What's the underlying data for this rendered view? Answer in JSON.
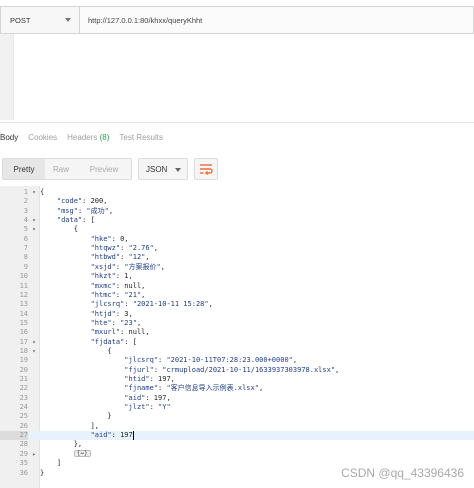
{
  "request": {
    "method": "POST",
    "url": "http://127.0.0.1:80/khxx/queryKhht"
  },
  "response_tabs": [
    {
      "label": "Body",
      "count": ""
    },
    {
      "label": "Cookies",
      "count": ""
    },
    {
      "label": "Headers",
      "count": "(8)"
    },
    {
      "label": "Test Results",
      "count": ""
    }
  ],
  "toolbar": {
    "views": [
      "Pretty",
      "Raw",
      "Preview"
    ],
    "active_view": "Pretty",
    "format": "JSON",
    "wrap_icon": "wrap-lines-icon"
  },
  "colors": {
    "highlight_line": "#e8f2ff",
    "accent": "#ef6c37",
    "string": "#1f3c8a"
  },
  "code_lines": [
    {
      "n": "1",
      "fold": "▾",
      "parts": [
        [
          "p",
          "{"
        ]
      ]
    },
    {
      "n": "2",
      "fold": "",
      "parts": [
        [
          "p",
          "    "
        ],
        [
          "k",
          "\"code\""
        ],
        [
          "p",
          ": 200,"
        ]
      ]
    },
    {
      "n": "3",
      "fold": "",
      "parts": [
        [
          "p",
          "    "
        ],
        [
          "k",
          "\"msg\""
        ],
        [
          "p",
          ": "
        ],
        [
          "s",
          "\"成功\""
        ],
        [
          "p",
          ","
        ]
      ]
    },
    {
      "n": "4",
      "fold": "▾",
      "parts": [
        [
          "p",
          "    "
        ],
        [
          "k",
          "\"data\""
        ],
        [
          "p",
          ": ["
        ]
      ]
    },
    {
      "n": "5",
      "fold": "▾",
      "parts": [
        [
          "p",
          "        {"
        ]
      ]
    },
    {
      "n": "6",
      "fold": "",
      "parts": [
        [
          "p",
          "            "
        ],
        [
          "k",
          "\"hke\""
        ],
        [
          "p",
          ": 0,"
        ]
      ]
    },
    {
      "n": "7",
      "fold": "",
      "parts": [
        [
          "p",
          "            "
        ],
        [
          "k",
          "\"htqwz\""
        ],
        [
          "p",
          ": "
        ],
        [
          "s",
          "\"2.76\""
        ],
        [
          "p",
          ","
        ]
      ]
    },
    {
      "n": "8",
      "fold": "",
      "parts": [
        [
          "p",
          "            "
        ],
        [
          "k",
          "\"htbwd\""
        ],
        [
          "p",
          ": "
        ],
        [
          "s",
          "\"12\""
        ],
        [
          "p",
          ","
        ]
      ]
    },
    {
      "n": "9",
      "fold": "",
      "parts": [
        [
          "p",
          "            "
        ],
        [
          "k",
          "\"xsjd\""
        ],
        [
          "p",
          ": "
        ],
        [
          "s",
          "\"方案报价\""
        ],
        [
          "p",
          ","
        ]
      ]
    },
    {
      "n": "10",
      "fold": "",
      "parts": [
        [
          "p",
          "            "
        ],
        [
          "k",
          "\"hkzt\""
        ],
        [
          "p",
          ": 1,"
        ]
      ]
    },
    {
      "n": "11",
      "fold": "",
      "parts": [
        [
          "p",
          "            "
        ],
        [
          "k",
          "\"mxmc\""
        ],
        [
          "p",
          ": null,"
        ]
      ]
    },
    {
      "n": "12",
      "fold": "",
      "parts": [
        [
          "p",
          "            "
        ],
        [
          "k",
          "\"htmc\""
        ],
        [
          "p",
          ": "
        ],
        [
          "s",
          "\"21\""
        ],
        [
          "p",
          ","
        ]
      ]
    },
    {
      "n": "13",
      "fold": "",
      "parts": [
        [
          "p",
          "            "
        ],
        [
          "k",
          "\"jlcsrq\""
        ],
        [
          "p",
          ": "
        ],
        [
          "s",
          "\"2021-10-11 15:28\""
        ],
        [
          "p",
          ","
        ]
      ]
    },
    {
      "n": "14",
      "fold": "",
      "parts": [
        [
          "p",
          "            "
        ],
        [
          "k",
          "\"htjd\""
        ],
        [
          "p",
          ": 3,"
        ]
      ]
    },
    {
      "n": "15",
      "fold": "",
      "parts": [
        [
          "p",
          "            "
        ],
        [
          "k",
          "\"hte\""
        ],
        [
          "p",
          ": "
        ],
        [
          "s",
          "\"23\""
        ],
        [
          "p",
          ","
        ]
      ]
    },
    {
      "n": "16",
      "fold": "",
      "parts": [
        [
          "p",
          "            "
        ],
        [
          "k",
          "\"mxurl\""
        ],
        [
          "p",
          ": null,"
        ]
      ]
    },
    {
      "n": "17",
      "fold": "▾",
      "parts": [
        [
          "p",
          "            "
        ],
        [
          "k",
          "\"fjdata\""
        ],
        [
          "p",
          ": ["
        ]
      ]
    },
    {
      "n": "18",
      "fold": "▾",
      "parts": [
        [
          "p",
          "                {"
        ]
      ]
    },
    {
      "n": "19",
      "fold": "",
      "parts": [
        [
          "p",
          "                    "
        ],
        [
          "k",
          "\"jlcsrq\""
        ],
        [
          "p",
          ": "
        ],
        [
          "s",
          "\"2021-10-11T07:28:23.000+0000\""
        ],
        [
          "p",
          ","
        ]
      ]
    },
    {
      "n": "20",
      "fold": "",
      "parts": [
        [
          "p",
          "                    "
        ],
        [
          "k",
          "\"fjurl\""
        ],
        [
          "p",
          ": "
        ],
        [
          "s",
          "\"crmupload/2021-10-11/1633937303978.xlsx\""
        ],
        [
          "p",
          ","
        ]
      ]
    },
    {
      "n": "21",
      "fold": "",
      "parts": [
        [
          "p",
          "                    "
        ],
        [
          "k",
          "\"htid\""
        ],
        [
          "p",
          ": 197,"
        ]
      ]
    },
    {
      "n": "22",
      "fold": "",
      "parts": [
        [
          "p",
          "                    "
        ],
        [
          "k",
          "\"fjname\""
        ],
        [
          "p",
          ": "
        ],
        [
          "s",
          "\"客户信息导入示例表.xlsx\""
        ],
        [
          "p",
          ","
        ]
      ]
    },
    {
      "n": "23",
      "fold": "",
      "parts": [
        [
          "p",
          "                    "
        ],
        [
          "k",
          "\"aid\""
        ],
        [
          "p",
          ": 197,"
        ]
      ]
    },
    {
      "n": "24",
      "fold": "",
      "parts": [
        [
          "p",
          "                    "
        ],
        [
          "k",
          "\"jlzt\""
        ],
        [
          "p",
          ": "
        ],
        [
          "s",
          "\"Y\""
        ]
      ]
    },
    {
      "n": "25",
      "fold": "",
      "parts": [
        [
          "p",
          "                }"
        ]
      ]
    },
    {
      "n": "26",
      "fold": "",
      "parts": [
        [
          "p",
          "            ],"
        ]
      ]
    },
    {
      "n": "27",
      "fold": "",
      "hl": true,
      "parts": [
        [
          "p",
          "            "
        ],
        [
          "k",
          "\"aid\""
        ],
        [
          "p",
          ": 197"
        ],
        [
          "c",
          ""
        ]
      ]
    },
    {
      "n": "28",
      "fold": "",
      "parts": [
        [
          "p",
          "        },"
        ]
      ]
    },
    {
      "n": "29",
      "fold": "▸",
      "parts": [
        [
          "p",
          "        "
        ],
        [
          "x",
          "{↔}"
        ]
      ]
    },
    {
      "n": "35",
      "fold": "",
      "parts": [
        [
          "p",
          "    ]"
        ]
      ]
    },
    {
      "n": "36",
      "fold": "",
      "parts": [
        [
          "p",
          "}"
        ]
      ]
    }
  ],
  "watermark": "CSDN @qq_43396436"
}
